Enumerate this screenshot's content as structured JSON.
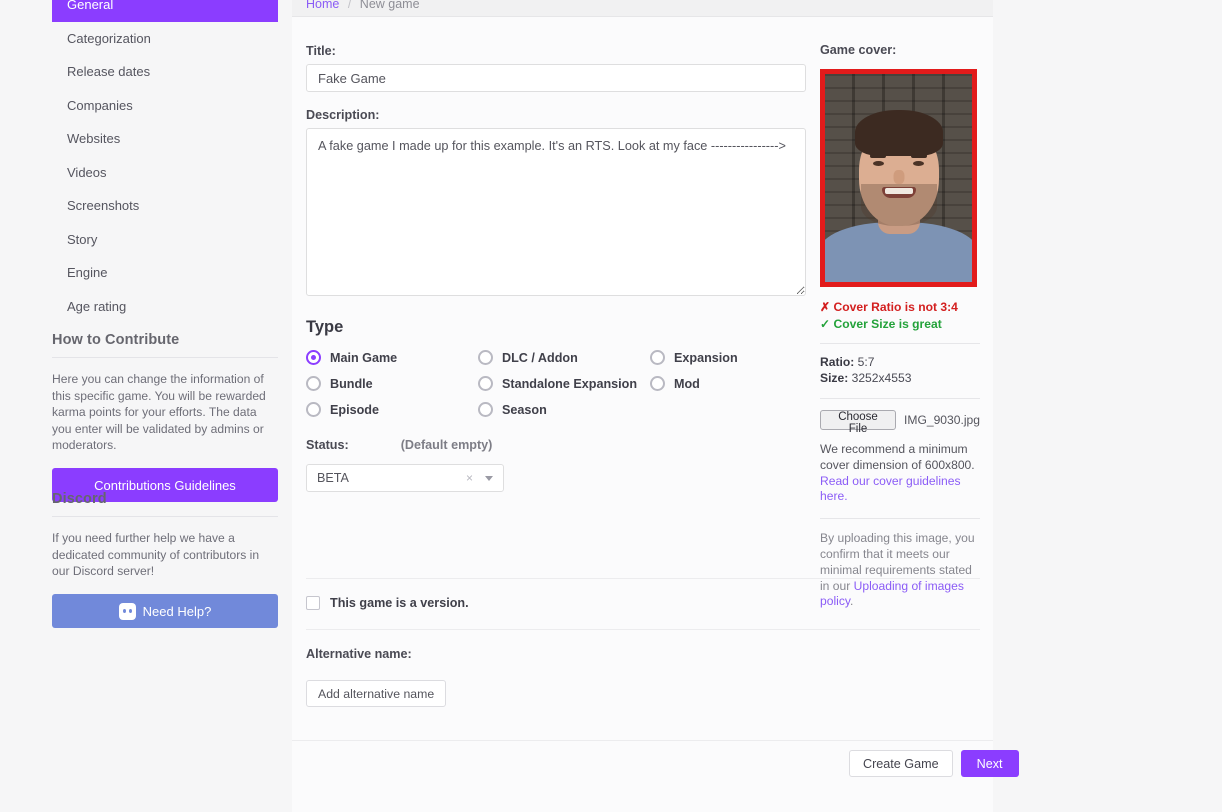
{
  "breadcrumb": {
    "home": "Home",
    "separator": "/",
    "current": "New game"
  },
  "sidebar": {
    "nav": [
      {
        "label": "General",
        "active": true
      },
      {
        "label": "Categorization",
        "active": false
      },
      {
        "label": "Release dates",
        "active": false
      },
      {
        "label": "Companies",
        "active": false
      },
      {
        "label": "Websites",
        "active": false
      },
      {
        "label": "Videos",
        "active": false
      },
      {
        "label": "Screenshots",
        "active": false
      },
      {
        "label": "Story",
        "active": false
      },
      {
        "label": "Engine",
        "active": false
      },
      {
        "label": "Age rating",
        "active": false
      }
    ],
    "contribute": {
      "heading": "How to Contribute",
      "body": "Here you can change the information of this specific game. You will be rewarded karma points for your efforts. The data you enter will be validated by admins or moderators.",
      "button": "Contributions Guidelines"
    },
    "discord": {
      "heading": "Discord",
      "body": "If you need further help we have a dedicated community of contributors in our Discord server!",
      "button": "Need Help?"
    }
  },
  "form": {
    "title_label": "Title:",
    "title_value": "Fake Game",
    "description_label": "Description:",
    "description_value": "A fake game I made up for this example. It's an RTS. Look at my face ---------------->",
    "type_heading": "Type",
    "types": [
      {
        "label": "Main Game",
        "checked": true
      },
      {
        "label": "DLC / Addon",
        "checked": false
      },
      {
        "label": "Expansion",
        "checked": false
      },
      {
        "label": "Bundle",
        "checked": false
      },
      {
        "label": "Standalone Expansion",
        "checked": false
      },
      {
        "label": "Mod",
        "checked": false
      },
      {
        "label": "Episode",
        "checked": false
      },
      {
        "label": "Season",
        "checked": false
      }
    ],
    "status_label": "Status:",
    "status_default_hint": "(Default empty)",
    "status_value": "BETA",
    "status_clear": "×",
    "version_checkbox_label": "This game is a version.",
    "version_checked": false,
    "alt_name_label": "Alternative name:",
    "add_alt_name_button": "Add alternative name"
  },
  "cover": {
    "label": "Game cover:",
    "validation": [
      {
        "mark": "✗",
        "text": "Cover Ratio is not 3:4",
        "ok": false
      },
      {
        "mark": "✓",
        "text": "Cover Size is great",
        "ok": true
      }
    ],
    "ratio_key": "Ratio:",
    "ratio_value": "5:7",
    "size_key": "Size:",
    "size_value": "3252x4553",
    "choose_file_button": "Choose File",
    "file_name": "IMG_9030.jpg",
    "recommend_text": "We recommend a minimum cover dimension of 600x800. ",
    "recommend_link": "Read our cover guidelines here.",
    "policy_text_a": "By uploading this image, you confirm that it meets our minimal requirements stated in our ",
    "policy_link": "Uploading of images policy",
    "policy_text_b": "."
  },
  "footer": {
    "create_button": "Create Game",
    "next_button": "Next"
  },
  "colors": {
    "accent_purple": "#8b3dff",
    "link_purple": "#8b5cf6",
    "discord_blue": "#7189da",
    "error_red": "#d31f1f",
    "success_green": "#23a23a",
    "cover_border_red": "#e21b1b"
  }
}
